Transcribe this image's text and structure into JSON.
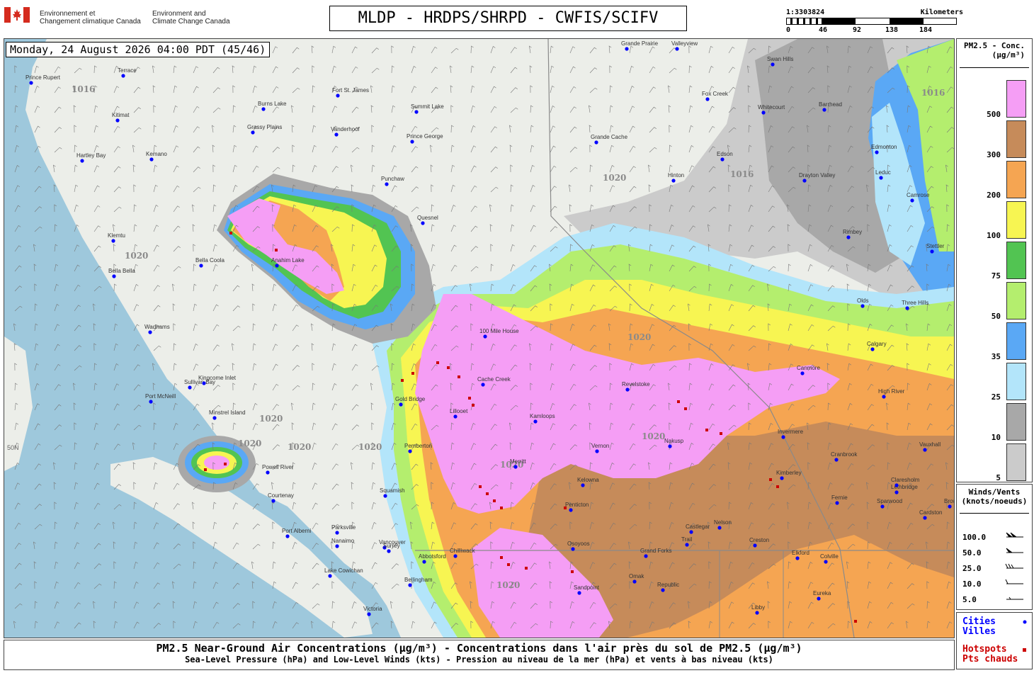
{
  "header": {
    "gov_fr_1": "Environnement et",
    "gov_fr_2": "Changement climatique Canada",
    "gov_en_1": "Environment and",
    "gov_en_2": "Climate Change Canada",
    "title": "MLDP - HRDPS/SHRPD - CWFIS/SCIFV"
  },
  "scale": {
    "ratio": "1:3303824",
    "unit_label": "Kilometers",
    "ticks": [
      "0",
      "46",
      "92",
      "138",
      "184"
    ]
  },
  "map": {
    "time_label": "Monday, 24 August 2026 04:00 PDT (45/46)",
    "isobars": [
      "1016",
      "1016",
      "1020",
      "1020",
      "1020",
      "1020",
      "1020",
      "1020",
      "1020",
      "1020",
      "1020",
      "1020",
      "1016"
    ],
    "lat_label": "50N",
    "cities": [
      {
        "name": "Prince Rupert"
      },
      {
        "name": "Terrace"
      },
      {
        "name": "Kitimat"
      },
      {
        "name": "Burns Lake"
      },
      {
        "name": "Fort St. James"
      },
      {
        "name": "Grassy Plains"
      },
      {
        "name": "Vanderhoof"
      },
      {
        "name": "Prince George"
      },
      {
        "name": "Summit Lake"
      },
      {
        "name": "Hartley Bay"
      },
      {
        "name": "Kemano"
      },
      {
        "name": "Klemtu"
      },
      {
        "name": "Bella Bella"
      },
      {
        "name": "Bella Coola"
      },
      {
        "name": "Anahim Lake"
      },
      {
        "name": "Punchaw"
      },
      {
        "name": "Quesnel"
      },
      {
        "name": "Grande Cache"
      },
      {
        "name": "Grande Prairie"
      },
      {
        "name": "Valleyview"
      },
      {
        "name": "Swan Hills"
      },
      {
        "name": "Fox Creek"
      },
      {
        "name": "Whitecourt"
      },
      {
        "name": "Barrhead"
      },
      {
        "name": "Edson"
      },
      {
        "name": "Hinton"
      },
      {
        "name": "Drayton Valley"
      },
      {
        "name": "Edmonton"
      },
      {
        "name": "Leduc"
      },
      {
        "name": "Camrose"
      },
      {
        "name": "Rimbey"
      },
      {
        "name": "Stettler"
      },
      {
        "name": "Olds"
      },
      {
        "name": "Three Hills"
      },
      {
        "name": "Wadhams"
      },
      {
        "name": "Sullivan Bay"
      },
      {
        "name": "Kingcome Inlet"
      },
      {
        "name": "Port McNeill"
      },
      {
        "name": "Minstrel Island"
      },
      {
        "name": "100 Mile House"
      },
      {
        "name": "Cache Creek"
      },
      {
        "name": "Gold Bridge"
      },
      {
        "name": "Lillooet"
      },
      {
        "name": "Kamloops"
      },
      {
        "name": "Revelstoke"
      },
      {
        "name": "Canmore"
      },
      {
        "name": "Calgary"
      },
      {
        "name": "High River"
      },
      {
        "name": "Invermere"
      },
      {
        "name": "Nakusp"
      },
      {
        "name": "Vernon"
      },
      {
        "name": "Merritt"
      },
      {
        "name": "Pemberton"
      },
      {
        "name": "Powell River"
      },
      {
        "name": "Courtenay"
      },
      {
        "name": "Squamish"
      },
      {
        "name": "Port Alberni"
      },
      {
        "name": "Parksville"
      },
      {
        "name": "Nanaimo"
      },
      {
        "name": "Vancouver"
      },
      {
        "name": "Surrey"
      },
      {
        "name": "Abbotsford"
      },
      {
        "name": "Chilliwack"
      },
      {
        "name": "Lake Cowichan"
      },
      {
        "name": "Victoria"
      },
      {
        "name": "Bellingham"
      },
      {
        "name": "Kelowna"
      },
      {
        "name": "Penticton"
      },
      {
        "name": "Osoyoos"
      },
      {
        "name": "Grand Forks"
      },
      {
        "name": "Castlegar"
      },
      {
        "name": "Trail"
      },
      {
        "name": "Nelson"
      },
      {
        "name": "Cranbrook"
      },
      {
        "name": "Kimberley"
      },
      {
        "name": "Fernie"
      },
      {
        "name": "Creston"
      },
      {
        "name": "Colville"
      },
      {
        "name": "Republic"
      },
      {
        "name": "Omak"
      },
      {
        "name": "Sandpoint"
      },
      {
        "name": "Libby"
      },
      {
        "name": "Eureka"
      },
      {
        "name": "Elkford"
      },
      {
        "name": "Sparwood"
      },
      {
        "name": "Lethbridge"
      },
      {
        "name": "Cardston"
      },
      {
        "name": "Claresholm"
      },
      {
        "name": "Vauxhall"
      },
      {
        "name": "Browning"
      }
    ]
  },
  "legend_pm": {
    "title_1": "PM2.5 - Conc.",
    "title_2": "(µg/m³)",
    "levels": [
      {
        "label": "500",
        "color": "#f59ef5"
      },
      {
        "label": "300",
        "color": "#c68b5a"
      },
      {
        "label": "200",
        "color": "#f5a552"
      },
      {
        "label": "100",
        "color": "#f7f552"
      },
      {
        "label": "75",
        "color": "#52c452"
      },
      {
        "label": "50",
        "color": "#b4ee6e"
      },
      {
        "label": "35",
        "color": "#5aa8f5"
      },
      {
        "label": "25",
        "color": "#b3e5fa"
      },
      {
        "label": "10",
        "color": "#a8a8a8"
      },
      {
        "label": "5",
        "color": "#cbcbcb"
      }
    ]
  },
  "legend_wind": {
    "title_1": "Winds/Vents",
    "title_2": "(knots/noeuds)",
    "rows": [
      "100.0",
      "50.0",
      "25.0",
      "10.0",
      "5.0"
    ]
  },
  "legend_key": {
    "cities_1": "Cities",
    "cities_2": "Villes",
    "hotspots_1": "Hotspots",
    "hotspots_2": "Pts chauds",
    "cities_color": "#0000ff",
    "hotspots_color": "#cc0000"
  },
  "footer": {
    "line_1": "PM2.5 Near-Ground Air Concentrations (µg/m³) - Concentrations dans l'air près du sol de PM2.5 (µg/m³)",
    "line_2": "Sea-Level Pressure (hPa) and Low-Level Winds (kts) - Pression au niveau de la mer (hPa) et vents à bas niveau (kts)"
  }
}
